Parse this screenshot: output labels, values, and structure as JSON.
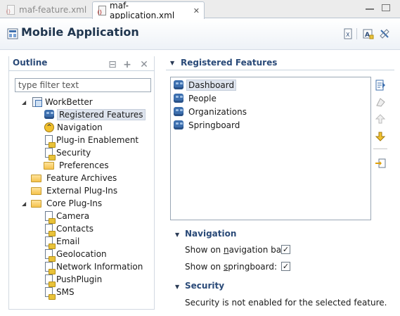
{
  "tabs": [
    {
      "label": "maf-feature.xml",
      "active": false
    },
    {
      "label": "maf-application.xml",
      "active": true
    }
  ],
  "editor": {
    "title": "Mobile Application"
  },
  "outline": {
    "title": "Outline",
    "filter_placeholder": "type filter text",
    "tree": {
      "root": "WorkBetter",
      "root_children": [
        "Registered Features",
        "Navigation",
        "Plug-in Enablement",
        "Security",
        "Preferences"
      ],
      "top_level": [
        "Feature Archives",
        "External Plug-Ins",
        "Core Plug-Ins"
      ],
      "core_plugins": [
        "Camera",
        "Contacts",
        "Email",
        "Geolocation",
        "Network Information",
        "PushPlugin",
        "SMS"
      ]
    },
    "selected": "Registered Features"
  },
  "registered_features": {
    "title": "Registered Features",
    "items": [
      "Dashboard",
      "People",
      "Organizations",
      "Springboard"
    ],
    "selected": "Dashboard"
  },
  "navigation": {
    "title": "Navigation",
    "nav_bar_label_pre": "Show on ",
    "nav_bar_label_ul": "n",
    "nav_bar_label_post": "avigation bar:",
    "nav_bar_checked": true,
    "springboard_label_pre": "Show on ",
    "springboard_label_ul": "s",
    "springboard_label_post": "pringboard:",
    "springboard_checked": true
  },
  "security": {
    "title": "Security",
    "message": "Security is not enabled for the selected feature."
  },
  "colors": {
    "section_title": "#2a4a78",
    "selection": "#dee4ee",
    "cube": "#3d6fae"
  }
}
